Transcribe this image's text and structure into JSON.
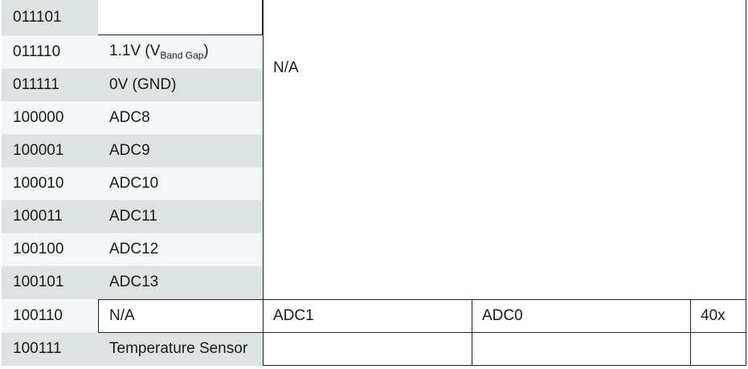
{
  "rows": [
    {
      "code": "011101",
      "desc": ""
    },
    {
      "code": "011110",
      "desc_main": "1.1V (V",
      "desc_sub": "Band Gap",
      "desc_end": ")"
    },
    {
      "code": "011111",
      "desc": "0V (GND)"
    },
    {
      "code": "100000",
      "desc": "ADC8"
    },
    {
      "code": "100001",
      "desc": "ADC9"
    },
    {
      "code": "100010",
      "desc": "ADC10"
    },
    {
      "code": "100011",
      "desc": "ADC11"
    },
    {
      "code": "100100",
      "desc": "ADC12"
    },
    {
      "code": "100101",
      "desc": "ADC13"
    },
    {
      "code": "100110",
      "desc": "N/A",
      "pos": "ADC1",
      "neg": "ADC0",
      "gain": "40x"
    },
    {
      "code": "100111",
      "desc": "Temperature Sensor",
      "pos": "",
      "neg": "",
      "gain": ""
    }
  ],
  "merged_na": "N/A"
}
